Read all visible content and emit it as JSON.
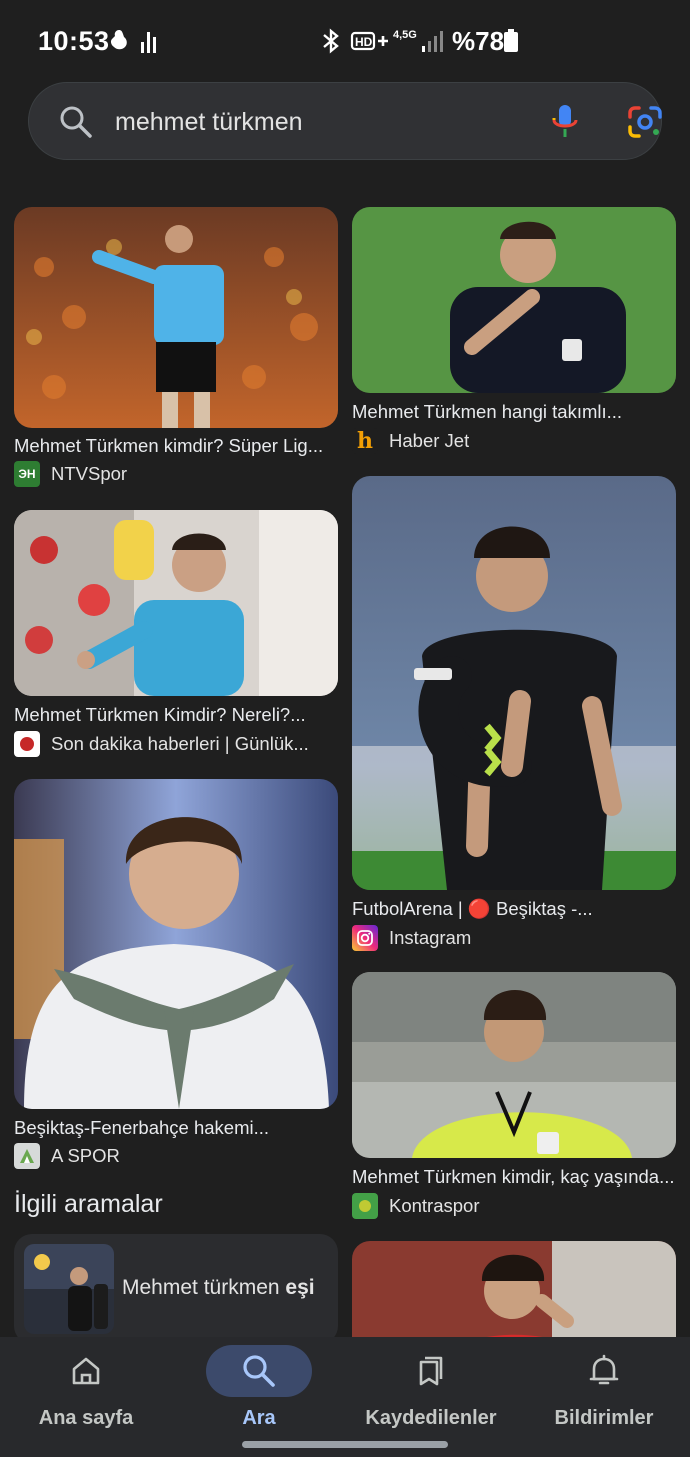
{
  "status_bar": {
    "time": "10:53",
    "network": "4,5G",
    "battery": "%78"
  },
  "search": {
    "query": "mehmet türkmen",
    "placeholder": ""
  },
  "results": [
    {
      "title": "Mehmet Türkmen kimdir? Süper Lig...",
      "source": "NTVSpor",
      "favicon_label": "ЭН",
      "favicon_color": "#2e7d32"
    },
    {
      "title": "Mehmet Türkmen hangi takımlı...",
      "source": "Haber Jet",
      "favicon_label": "h",
      "favicon_color": "#f29f05"
    },
    {
      "title": "Mehmet Türkmen Kimdir? Nereli?...",
      "source": "Son dakika haberleri | Günlük...",
      "favicon_label": "",
      "favicon_color": "#c62828"
    },
    {
      "title": "FutbolArena | 🔴 Beşiktaş -...",
      "source": "Instagram",
      "favicon_label": "",
      "favicon_color": "#d6249f"
    },
    {
      "title": "Beşiktaş-Fenerbahçe hakemi...",
      "source": "A SPOR",
      "favicon_label": "",
      "favicon_color": "#9e9e9e"
    },
    {
      "title": "Mehmet Türkmen kimdir, kaç yaşında...",
      "source": "Kontraspor",
      "favicon_label": "",
      "favicon_color": "#43a047"
    }
  ],
  "related": {
    "heading": "İlgili aramalar",
    "item_prefix": "Mehmet türkmen ",
    "item_bold": "eşi"
  },
  "bottom_nav": [
    {
      "label": "Ana sayfa",
      "icon": "home-icon",
      "active": false
    },
    {
      "label": "Ara",
      "icon": "search-icon",
      "active": true
    },
    {
      "label": "Kaydedilenler",
      "icon": "collections-icon",
      "active": false
    },
    {
      "label": "Bildirimler",
      "icon": "bell-icon",
      "active": false
    }
  ],
  "colors": {
    "background": "#1f1f1f",
    "search_bar": "#303134",
    "active_nav": "#3c4a6b",
    "active_label": "#a8c7fa"
  }
}
